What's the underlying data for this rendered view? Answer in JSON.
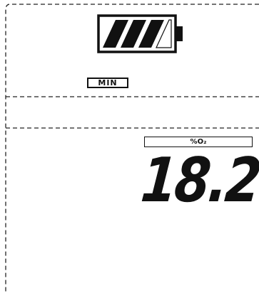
{
  "battery": {
    "icon": "battery-icon",
    "charge_level": 0.6
  },
  "top_section": {
    "min_label": "MIN"
  },
  "bottom_section": {
    "unit_label": "%O₂",
    "reading": "18.2"
  }
}
